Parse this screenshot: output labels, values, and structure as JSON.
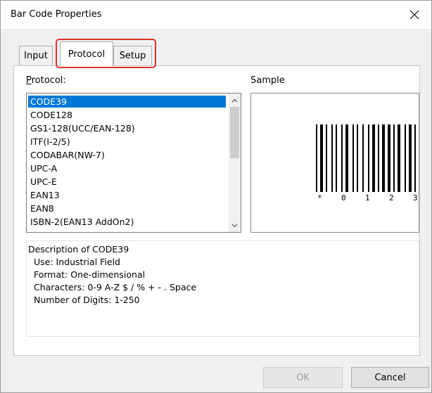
{
  "window": {
    "title": "Bar Code Properties"
  },
  "tabs": [
    {
      "label": "Input"
    },
    {
      "label": "Protocol"
    },
    {
      "label": "Setup"
    }
  ],
  "protocol": {
    "label_prefix": "P",
    "label_rest": "rotocol:",
    "items": [
      "CODE39",
      "CODE128",
      "GS1-128(UCC/EAN-128)",
      "ITF(I-2/5)",
      "CODABAR(NW-7)",
      "UPC-A",
      "UPC-E",
      "EAN13",
      "EAN8",
      "ISBN-2(EAN13 AddOn2)"
    ],
    "selected": "CODE39"
  },
  "sample": {
    "label": "Sample",
    "chars": [
      "*",
      "0",
      "1",
      "2",
      "3"
    ]
  },
  "description": {
    "title": "Description of CODE39",
    "use": "Use: Industrial Field",
    "format": "Format: One-dimensional",
    "characters": "Characters: 0-9 A-Z $ / % + - . Space",
    "digits": "Number of Digits: 1-250"
  },
  "buttons": {
    "ok": "OK",
    "cancel": "Cancel"
  },
  "colors": {
    "selection": "#0078d7",
    "highlight": "#e03131"
  }
}
